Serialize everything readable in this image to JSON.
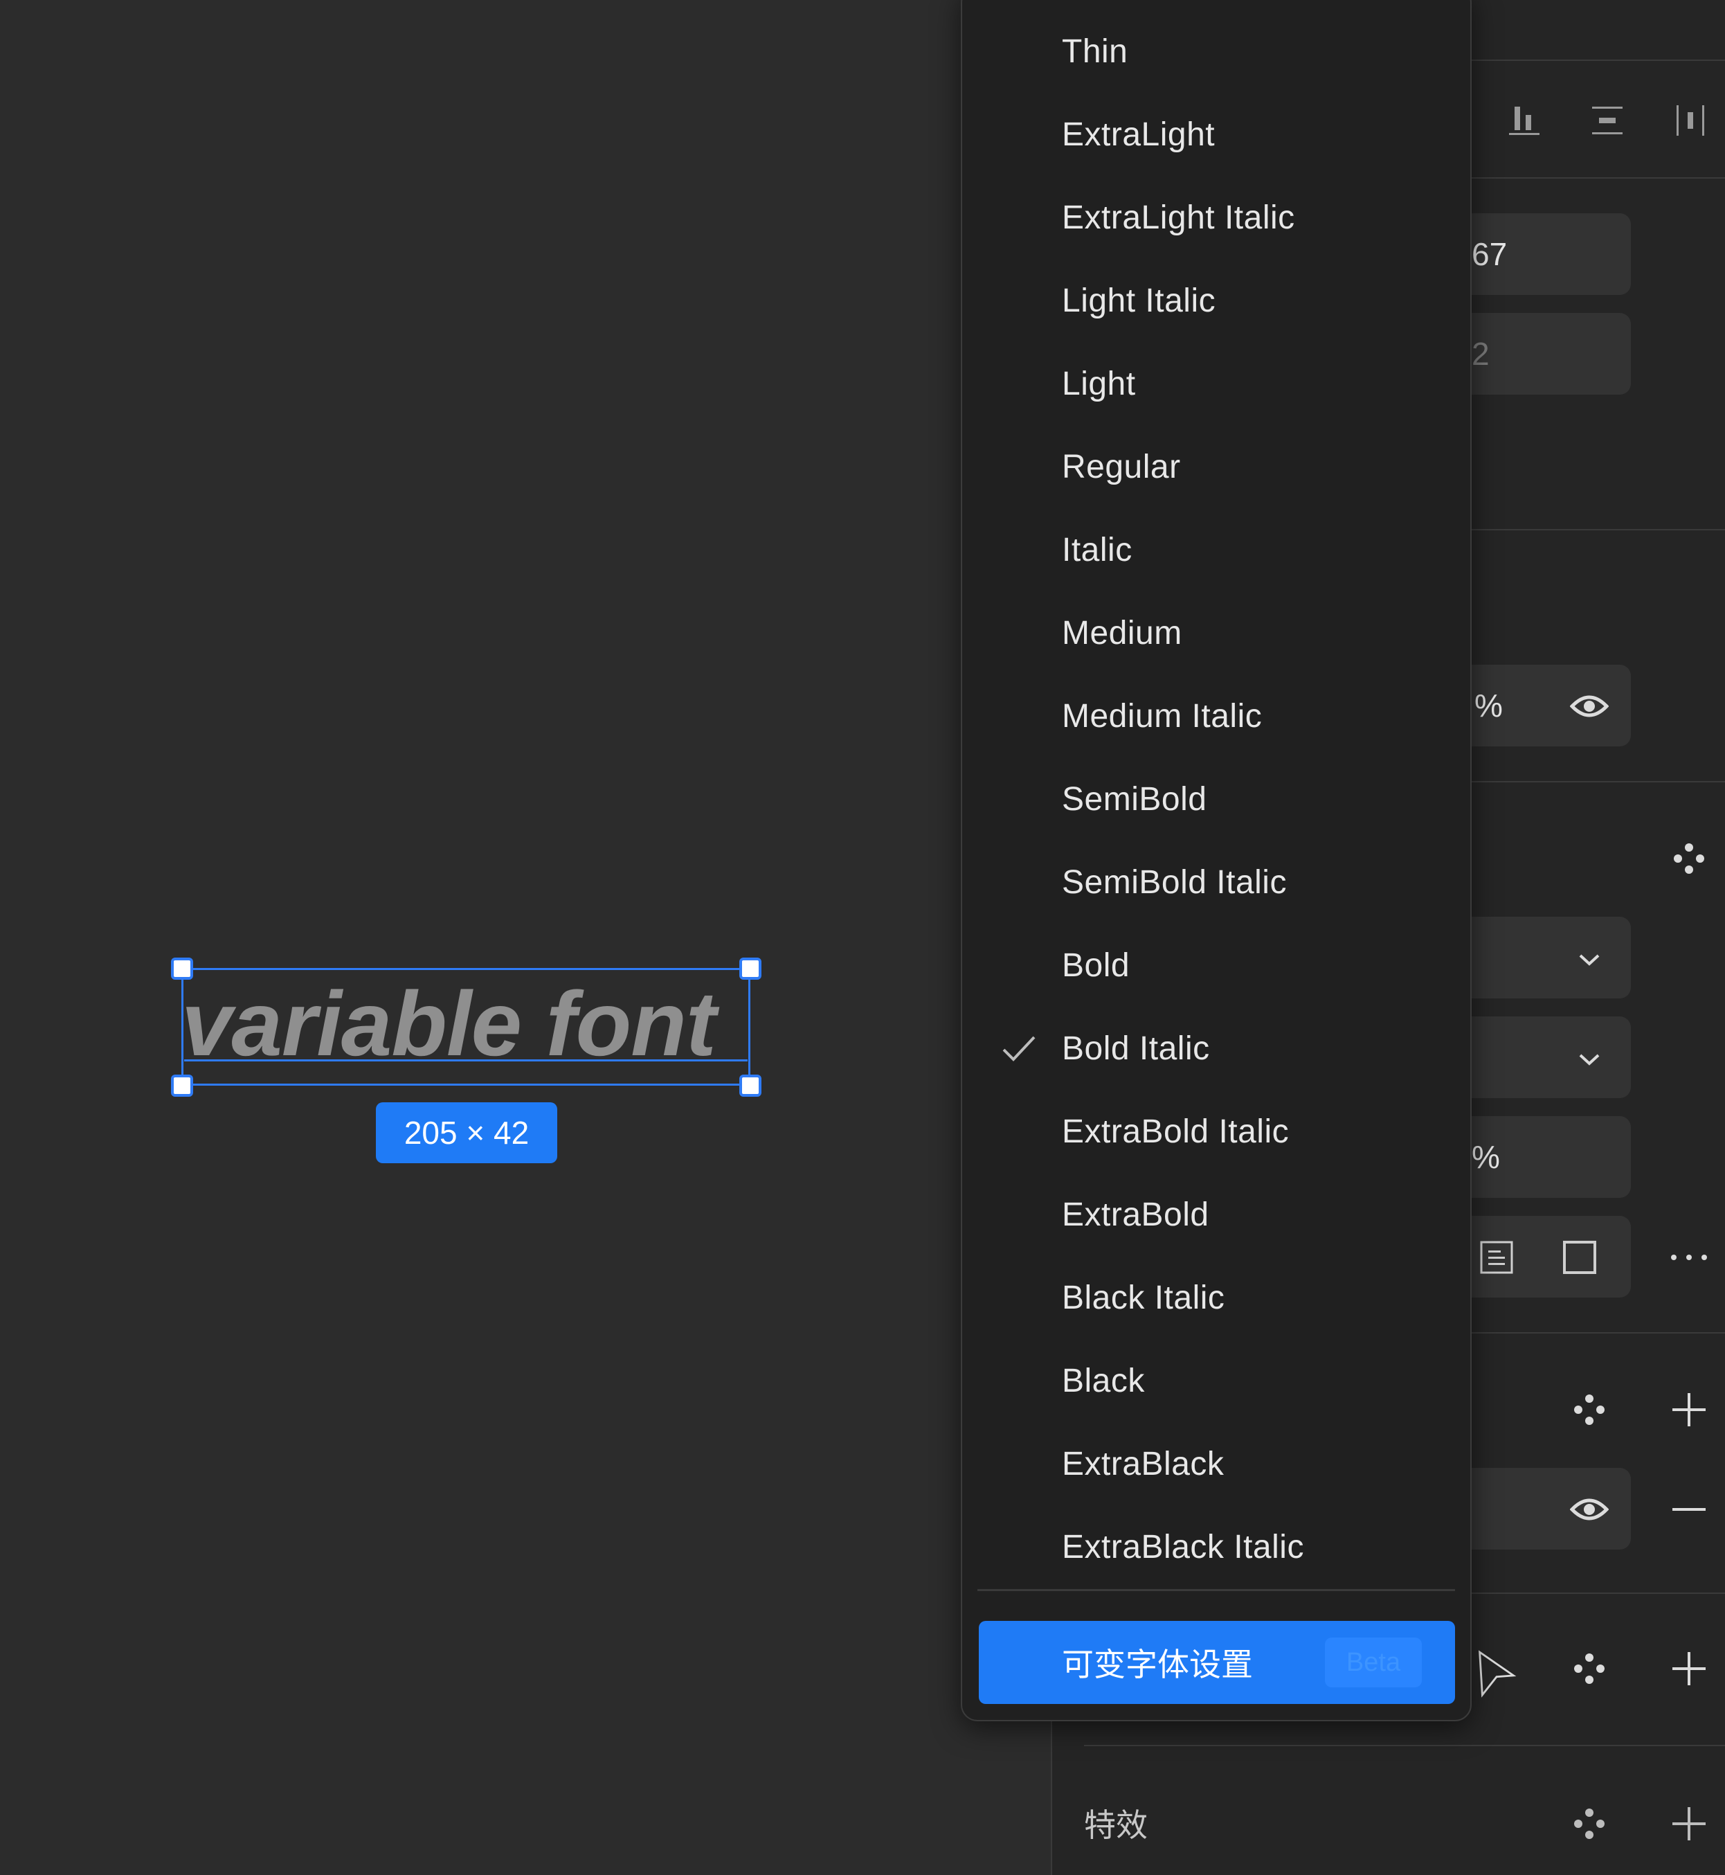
{
  "canvas": {
    "sample_text": "variable font",
    "dimension_badge": "205 × 42"
  },
  "panel": {
    "field_1_value": "67",
    "field_2_value": "2",
    "opacity_suffix_1": "%",
    "opacity_suffix_2": "%",
    "effects_label": "特效"
  },
  "font_style_menu": {
    "options": [
      {
        "label": "Thin"
      },
      {
        "label": "ExtraLight"
      },
      {
        "label": "ExtraLight Italic"
      },
      {
        "label": "Light Italic"
      },
      {
        "label": "Light"
      },
      {
        "label": "Regular"
      },
      {
        "label": "Italic"
      },
      {
        "label": "Medium"
      },
      {
        "label": "Medium Italic"
      },
      {
        "label": "SemiBold"
      },
      {
        "label": "SemiBold Italic"
      },
      {
        "label": "Bold"
      },
      {
        "label": "Bold Italic"
      },
      {
        "label": "ExtraBold Italic"
      },
      {
        "label": "ExtraBold"
      },
      {
        "label": "Black Italic"
      },
      {
        "label": "Black"
      },
      {
        "label": "ExtraBlack"
      },
      {
        "label": "ExtraBlack Italic"
      }
    ],
    "selected": "Bold Italic",
    "variable_font_button": "可变字体设置",
    "beta_badge": "Beta"
  },
  "colors": {
    "accent": "#1f7bf6",
    "canvas_bg": "#2c2c2c",
    "menu_bg": "#202020",
    "panel_bg": "#252525"
  },
  "icons": [
    "check-icon",
    "eye-icon",
    "chevron-down-icon",
    "component-icon",
    "plus-icon",
    "minus-icon",
    "more-icon",
    "cursor-icon",
    "align-bottom-icon",
    "align-center-icon",
    "distribute-icon",
    "text-box-icon",
    "square-icon"
  ]
}
